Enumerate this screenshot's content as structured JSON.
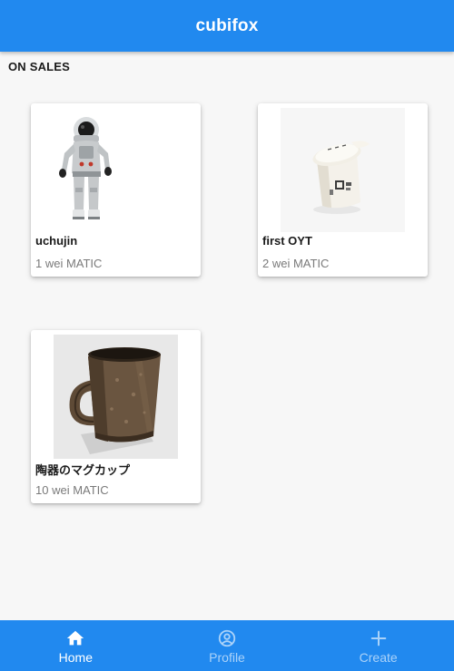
{
  "app": {
    "title": "cubifox",
    "accent_color": "#2189ef"
  },
  "section": {
    "title": "ON SALES"
  },
  "items": [
    {
      "name": "uchujin",
      "price": "1 wei MATIC",
      "image": "astronaut-model"
    },
    {
      "name": "first OYT",
      "price": "2 wei MATIC",
      "image": "yogurt-cup-model"
    },
    {
      "name": "陶器のマグカップ",
      "price": "10 wei MATIC",
      "image": "ceramic-mug-model"
    }
  ],
  "bottom_nav": {
    "items": [
      {
        "label": "Home",
        "icon": "home-icon",
        "active": true
      },
      {
        "label": "Profile",
        "icon": "account-circle-icon",
        "active": false
      },
      {
        "label": "Create",
        "icon": "plus-icon",
        "active": false
      }
    ]
  }
}
